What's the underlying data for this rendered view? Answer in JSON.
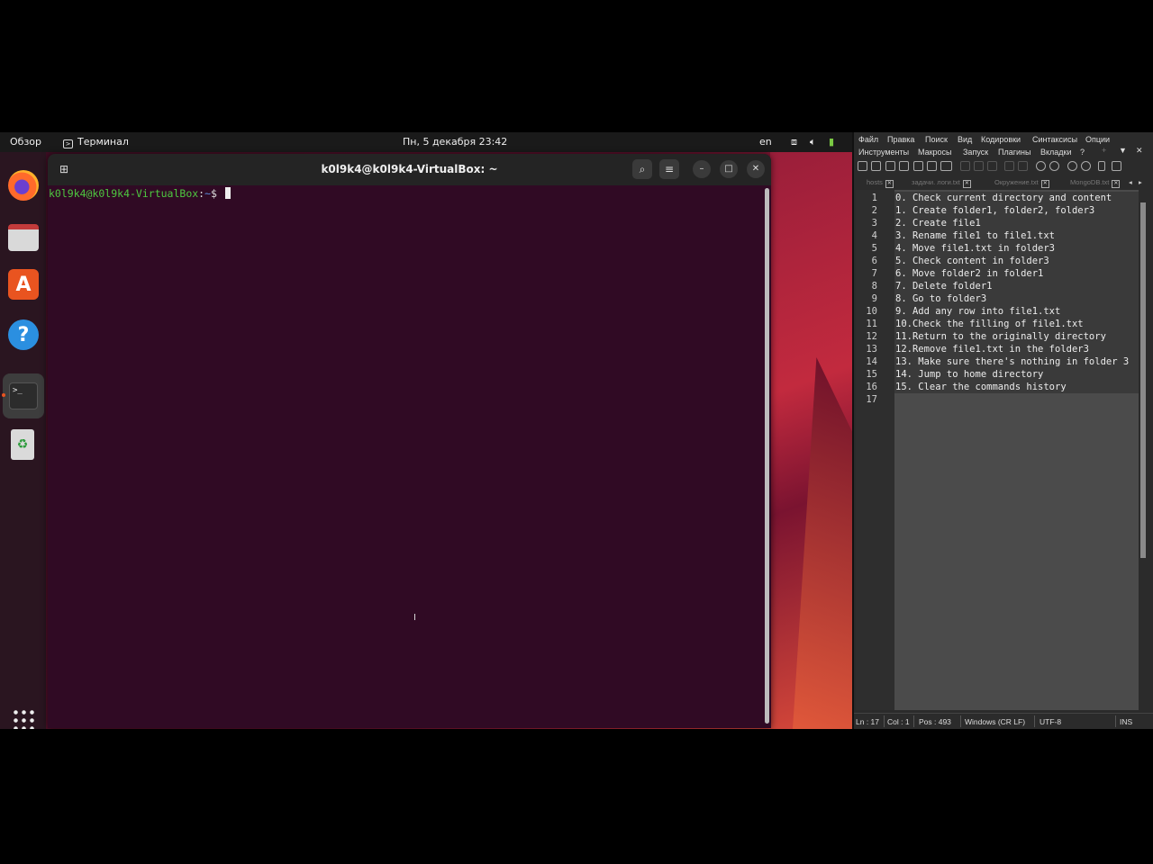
{
  "topbar": {
    "overview": "Обзор",
    "app_name": "Терминал",
    "clock": "Пн, 5 декабря  23:42",
    "language": "en"
  },
  "dock": {
    "items": [
      "firefox-icon",
      "files-icon",
      "app-center-icon",
      "help-icon",
      "terminal-icon",
      "trash-icon",
      "show-apps-icon"
    ]
  },
  "terminal": {
    "title": "k0l9k4@k0l9k4-VirtualBox: ~",
    "prompt_user": "k0l9k4@k0l9k4-VirtualBox",
    "prompt_sep": ":",
    "prompt_path": "~",
    "prompt_end": "$ "
  },
  "editor": {
    "menu_row1": [
      "Файл",
      "Правка",
      "Поиск",
      "Вид",
      "Кодировки",
      "Синтаксисы",
      "Опции"
    ],
    "menu_row2": [
      "Инструменты",
      "Макросы",
      "Запуск",
      "Плагины",
      "Вкладки",
      "?"
    ],
    "tabs": [
      "hosts",
      "задачи. логи.txt",
      "Окружение.txt",
      "MongoDB.txt"
    ],
    "lines": [
      "0. Check current directory and content",
      "1. Create folder1, folder2, folder3",
      "2. Create file1",
      "3. Rename file1 to file1.txt",
      "4. Move file1.txt in folder3",
      "5. Check content in folder3",
      "6. Move folder2 in folder1",
      "7. Delete folder1",
      "8. Go to folder3",
      "9. Add any row into file1.txt",
      "10.Check the filling of file1.txt",
      "11.Return to the originally directory",
      "12.Remove file1.txt in the folder3",
      "13. Make sure there's nothing in folder 3",
      "14. Jump to home directory",
      "15. Clear the commands history",
      ""
    ],
    "status": {
      "ln": "Ln : 17",
      "col": "Col : 1",
      "pos": "Pos : 493",
      "eol": "Windows (CR LF)",
      "encoding": "UTF-8",
      "mode": "INS"
    }
  }
}
